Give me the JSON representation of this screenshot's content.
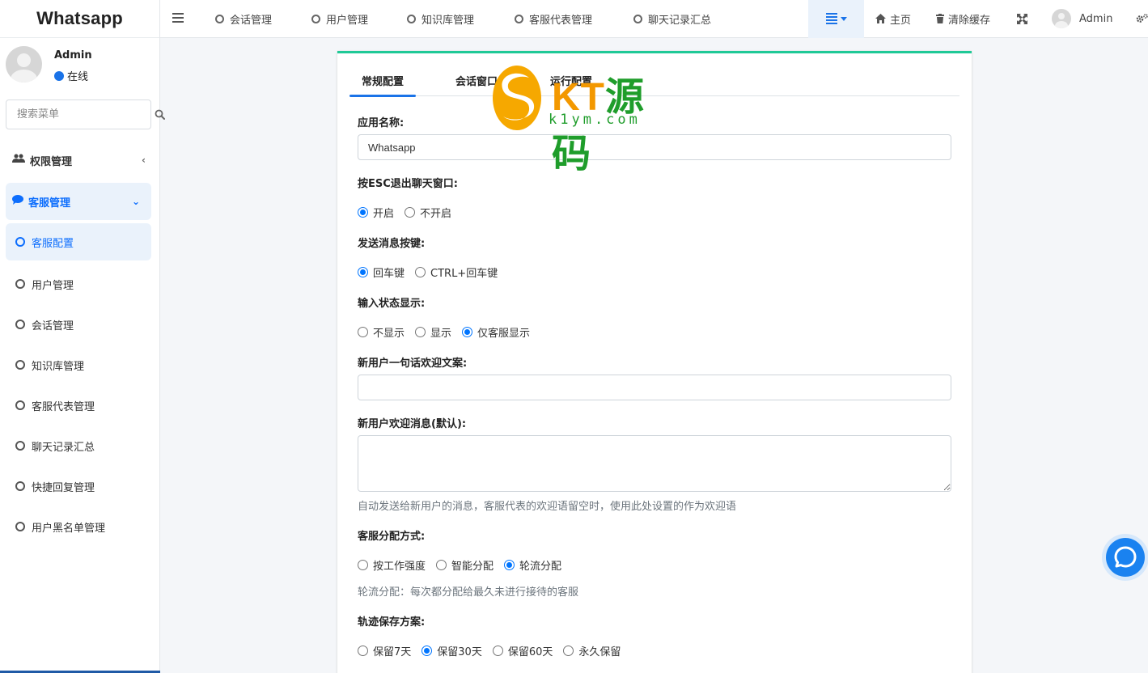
{
  "brand": "Whatsapp",
  "user": {
    "name": "Admin",
    "status": "在线"
  },
  "sidebar": {
    "search_placeholder": "搜索菜单",
    "groups": [
      {
        "label": "权限管理",
        "icon": "users-icon",
        "expanded": false
      },
      {
        "label": "客服管理",
        "icon": "comment-icon",
        "expanded": true
      }
    ],
    "items": [
      {
        "label": "客服配置",
        "active": true
      },
      {
        "label": "用户管理"
      },
      {
        "label": "会话管理"
      },
      {
        "label": "知识库管理"
      },
      {
        "label": "客服代表管理"
      },
      {
        "label": "聊天记录汇总"
      },
      {
        "label": "快捷回复管理"
      },
      {
        "label": "用户黑名单管理"
      }
    ]
  },
  "topnav": {
    "tabs": [
      "会话管理",
      "用户管理",
      "知识库管理",
      "客服代表管理",
      "聊天记录汇总"
    ],
    "home": "主页",
    "clear_cache": "清除缓存",
    "admin": "Admin"
  },
  "card": {
    "tabs": [
      "常规配置",
      "会话窗口",
      "运行配置"
    ],
    "active_tab": "常规配置",
    "form": {
      "app_name_label": "应用名称:",
      "app_name_value": "Whatsapp",
      "esc_label": "按ESC退出聊天窗口:",
      "esc_options": [
        "开启",
        "不开启"
      ],
      "esc_selected": 0,
      "send_key_label": "发送消息按键:",
      "send_key_options": [
        "回车键",
        "CTRL+回车键"
      ],
      "send_key_selected": 0,
      "typing_label": "输入状态显示:",
      "typing_options": [
        "不显示",
        "显示",
        "仅客服显示"
      ],
      "typing_selected": 2,
      "welcome_line_label": "新用户一句话欢迎文案:",
      "welcome_line_value": "",
      "welcome_msg_label": "新用户欢迎消息(默认):",
      "welcome_msg_value": "",
      "welcome_msg_help": "自动发送给新用户的消息，客服代表的欢迎语留空时，使用此处设置的作为欢迎语",
      "assign_label": "客服分配方式:",
      "assign_options": [
        "按工作强度",
        "智能分配",
        "轮流分配"
      ],
      "assign_selected": 2,
      "assign_help": "轮流分配：每次都分配给最久未进行接待的客服",
      "track_label": "轨迹保存方案:",
      "track_options": [
        "保留7天",
        "保留30天",
        "保留60天",
        "永久保留"
      ],
      "track_selected": 1
    }
  },
  "watermark": {
    "text_orange": "KT",
    "text_green": "源码",
    "sub": "k1ym.com"
  },
  "colors": {
    "accent": "#1a73e8",
    "card_top": "#20c997",
    "active_bg": "#eaf2fb"
  }
}
